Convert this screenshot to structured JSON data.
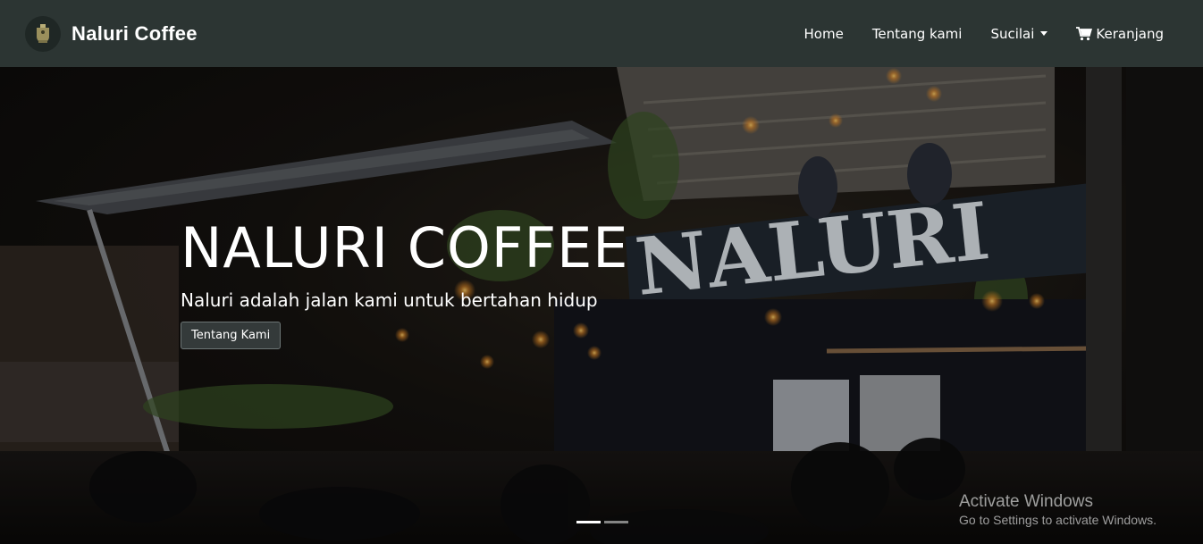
{
  "navbar": {
    "brand_name": "Naluri Coffee",
    "links": [
      {
        "label": "Home"
      },
      {
        "label": "Tentang kami"
      },
      {
        "label": "Sucilai"
      },
      {
        "label": "Keranjang"
      }
    ],
    "background": "#2c3533"
  },
  "hero": {
    "title": "NALURI COFFEE",
    "subtitle": "Naluri adalah jalan kami untuk bertahan hidup",
    "button_label": "Tentang Kami",
    "sign_text": "NALURI",
    "slide_count": 2,
    "active_slide": 1
  },
  "watermark": {
    "title": "Activate Windows",
    "subtitle": "Go to Settings to activate Windows."
  },
  "icons": {
    "brand": "coffee-logo-icon",
    "dropdown": "caret-down-icon",
    "cart": "cart-icon"
  }
}
